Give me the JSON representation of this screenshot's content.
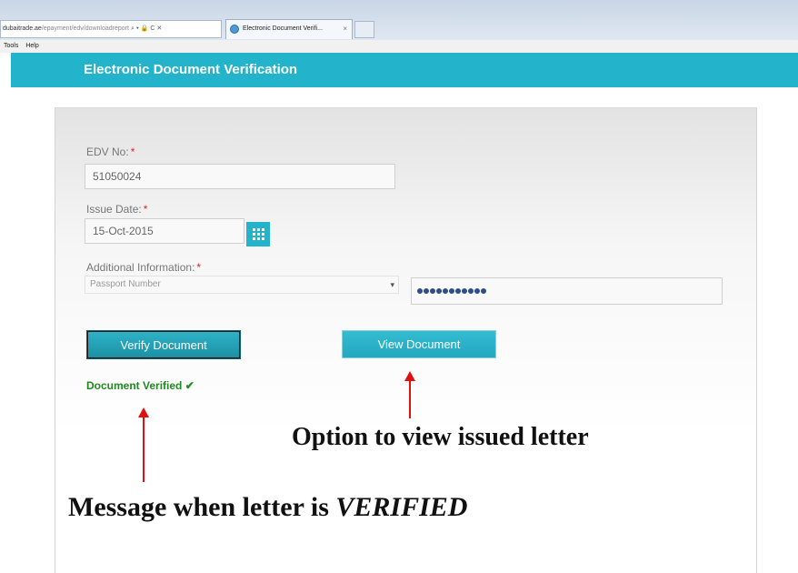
{
  "browser": {
    "address_domain": "dubaitrade.ae",
    "address_path": "/epayment/edv/downloadreport",
    "address_controls": "⌕ ▾ 🔒 C ✕",
    "tab_title": "Electronic Document Verifi...",
    "tab_close": "×",
    "menu": [
      "Tools",
      "Help"
    ]
  },
  "page": {
    "title": "Electronic Document Verification"
  },
  "form": {
    "edv_label": "EDV No:",
    "edv_value": "51050024",
    "issue_date_label": "Issue Date:",
    "issue_date_value": "15-Oct-2015",
    "additional_label": "Additional Information:",
    "required_mark": "*",
    "select_value": "Passport Number",
    "select_caret": "▾",
    "verify_button": "Verify Document",
    "view_button": "View Document",
    "verified_message": "Document Verified ✔"
  },
  "annotations": {
    "view_note": "Option to view issued letter",
    "verified_note_prefix": "Message when letter is ",
    "verified_note_emphasis": "VERIFIED"
  },
  "colors": {
    "accent": "#23b4cb",
    "verified_green": "#1f8a1f",
    "required_red": "#e02020",
    "arrow_red": "#e01010"
  },
  "icons": [
    "calendar-icon",
    "browser-tab-icon",
    "check-icon"
  ]
}
